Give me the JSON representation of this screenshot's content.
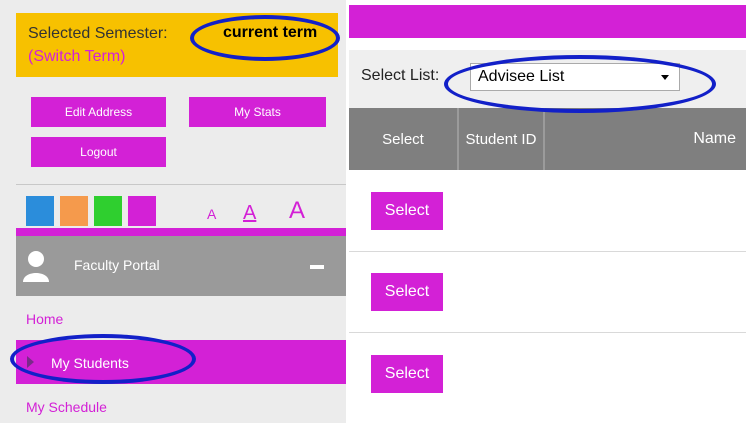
{
  "semester": {
    "label": "Selected Semester:",
    "value": "current term",
    "switch_label": "(Switch Term)"
  },
  "buttons": {
    "edit_address": "Edit Address",
    "my_stats": "My Stats",
    "logout": "Logout"
  },
  "theme_swatches": [
    {
      "name": "blue",
      "color": "#2b8ddb"
    },
    {
      "name": "orange",
      "color": "#f59a4c"
    },
    {
      "name": "green",
      "color": "#2fcf2f"
    },
    {
      "name": "magenta",
      "color": "#d321d6"
    }
  ],
  "font_size_controls": [
    "A",
    "A",
    "A"
  ],
  "portal": {
    "title": "Faculty Portal",
    "collapse_icon": "minus-icon",
    "avatar_icon": "user-icon"
  },
  "nav": {
    "home": "Home",
    "my_students": "My Students",
    "my_schedule": "My Schedule"
  },
  "select_list": {
    "label": "Select List:",
    "value": "Advisee List"
  },
  "table": {
    "headers": [
      "Select",
      "Student ID",
      "Name"
    ],
    "rows": [
      {
        "action": "Select"
      },
      {
        "action": "Select"
      },
      {
        "action": "Select"
      }
    ]
  },
  "colors": {
    "accent": "#d321d6",
    "semester_bg": "#f7c100",
    "header_gray": "#7f7f7f",
    "annotation": "#1220c8"
  }
}
